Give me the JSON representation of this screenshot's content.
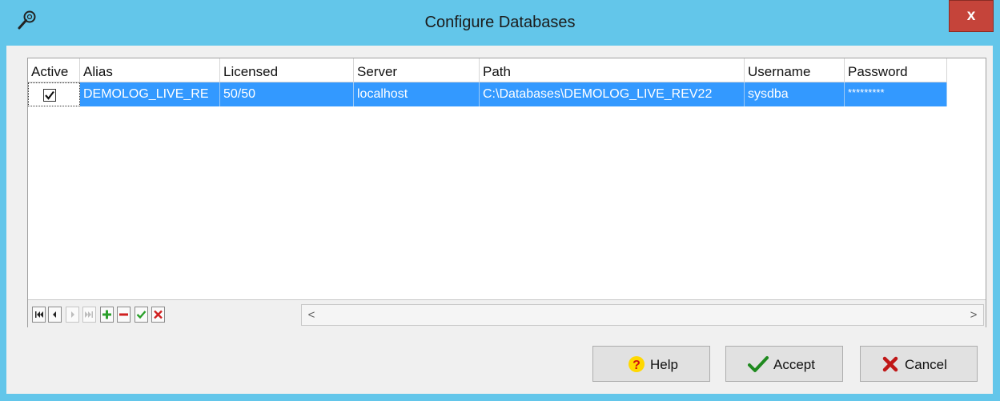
{
  "window": {
    "title": "Configure Databases",
    "close_label": "x",
    "app_icon": "wrench-icon"
  },
  "grid": {
    "columns": [
      "Active",
      "Alias",
      "Licensed",
      "Server",
      "Path",
      "Username",
      "Password"
    ],
    "rows": [
      {
        "active": true,
        "alias": "DEMOLOG_LIVE_RE",
        "licensed": "50/50",
        "server": "localhost",
        "path": "C:\\Databases\\DEMOLOG_LIVE_REV22",
        "username": "sysdba",
        "password": "*********"
      }
    ],
    "ellipsis_label": "···"
  },
  "navigator": {
    "buttons": [
      "first-record",
      "prior-record",
      "next-record",
      "last-record",
      "insert-record",
      "delete-record",
      "post-edit",
      "cancel-edit"
    ]
  },
  "scrollbar": {
    "left_arrow": "<",
    "right_arrow": ">"
  },
  "colors": {
    "titlebar": "#63c6ea",
    "selection": "#3399ff",
    "close": "#c5443a"
  },
  "buttons": {
    "help": "Help",
    "accept": "Accept",
    "cancel": "Cancel"
  }
}
